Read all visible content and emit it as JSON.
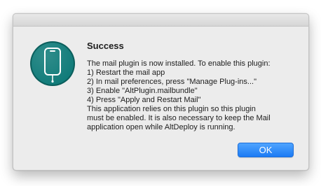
{
  "dialog": {
    "icon": "phone-icon",
    "title": "Success",
    "message_lines": [
      "The mail plugin is now installed. To enable this plugin:",
      "1) Restart the mail app",
      "2) In mail preferences, press \"Manage Plug-ins...\"",
      "3) Enable \"AltPlugin.mailbundle\"",
      "4) Press \"Apply and Restart Mail\"",
      "This application relies on this plugin so this plugin",
      "must be enabled. It is also necessary to keep the Mail",
      "application open while AltDeploy is running."
    ],
    "ok_label": "OK"
  },
  "colors": {
    "icon_background": "#0e7a78",
    "icon_ring": "#0b5e5c",
    "button_accent": "#1c7bf4"
  }
}
